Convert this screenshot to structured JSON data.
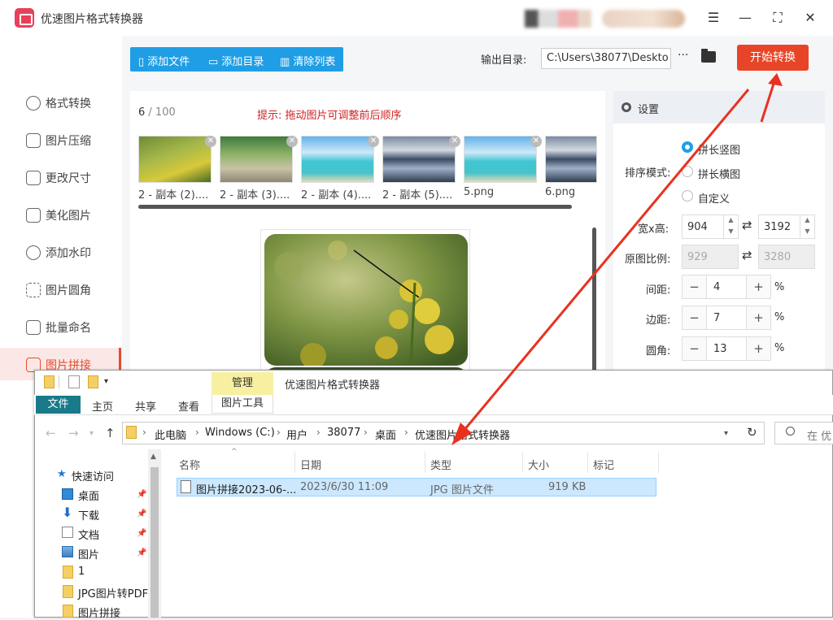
{
  "app": {
    "title": "优速图片格式转换器"
  },
  "window_controls": {
    "menu": "☰",
    "minimize": "—",
    "maximize": "⛶",
    "close": "✕"
  },
  "sidebar": {
    "items": [
      {
        "label": "格式转换",
        "icon": "convert-icon"
      },
      {
        "label": "图片压缩",
        "icon": "compress-icon"
      },
      {
        "label": "更改尺寸",
        "icon": "resize-icon"
      },
      {
        "label": "美化图片",
        "icon": "beautify-icon"
      },
      {
        "label": "添加水印",
        "icon": "watermark-icon"
      },
      {
        "label": "图片圆角",
        "icon": "round-corner-icon"
      },
      {
        "label": "批量命名",
        "icon": "rename-icon"
      },
      {
        "label": "图片拼接",
        "icon": "stitch-icon",
        "active": true
      }
    ]
  },
  "toolbar": {
    "add_file": "添加文件",
    "add_dir": "添加目录",
    "clear_list": "清除列表",
    "output_label": "输出目录:",
    "output_path": "C:\\Users\\38077\\Deskto",
    "more": "···",
    "start": "开始转换"
  },
  "list": {
    "count": "6",
    "max": "/ 100",
    "hint": "提示: 拖动图片可调整前后顺序",
    "thumbs": [
      {
        "label": "2 - 副本 (2)....",
        "kind": "flower"
      },
      {
        "label": "2 - 副本 (3)....",
        "kind": "river"
      },
      {
        "label": "2 - 副本 (4)....",
        "kind": "beach"
      },
      {
        "label": "2 - 副本 (5)....",
        "kind": "mountain"
      },
      {
        "label": "5.png",
        "kind": "beach"
      },
      {
        "label": "6.png",
        "kind": "mountain"
      }
    ]
  },
  "settings": {
    "title": "设置",
    "sort_label": "排序模式:",
    "sort_options": [
      "拼长竖图",
      "拼长横图",
      "自定义"
    ],
    "sort_selected": 0,
    "wh_label": "宽x高:",
    "width": "904",
    "height": "3192",
    "ratio_label": "原图比例:",
    "ratio_w": "929",
    "ratio_h": "3280",
    "spacing_label": "间距:",
    "spacing": "4",
    "margin_label": "边距:",
    "margin": "7",
    "corner_label": "圆角:",
    "corner": "13",
    "unit": "%"
  },
  "explorer": {
    "title": "优速图片格式转换器",
    "manage_tab": "管理",
    "tabs": [
      "文件",
      "主页",
      "共享",
      "查看"
    ],
    "picture_tools": "图片工具",
    "breadcrumb": [
      "此电脑",
      "Windows (C:)",
      "用户",
      "38077",
      "桌面",
      "优速图片格式转换器"
    ],
    "search_placeholder": "在 优",
    "nav": [
      {
        "label": "快速访问",
        "icon": "star-icon"
      },
      {
        "label": "桌面",
        "icon": "desktop-icon",
        "pinned": true
      },
      {
        "label": "下载",
        "icon": "download-icon",
        "pinned": true
      },
      {
        "label": "文档",
        "icon": "document-icon",
        "pinned": true
      },
      {
        "label": "图片",
        "icon": "pictures-icon",
        "pinned": true
      },
      {
        "label": "1",
        "icon": "folder-icon"
      },
      {
        "label": "JPG图片转PDF",
        "icon": "folder-icon"
      },
      {
        "label": "图片拼接",
        "icon": "folder-icon"
      }
    ],
    "columns": [
      "名称",
      "日期",
      "类型",
      "大小",
      "标记"
    ],
    "files": [
      {
        "name": "图片拼接2023-06-...",
        "date": "2023/6/30 11:09",
        "type": "JPG 图片文件",
        "size": "919 KB"
      }
    ]
  },
  "colors": {
    "accent": "#1f9ee6",
    "start": "#e84528",
    "hint": "#d02323",
    "arrow": "#e8321f"
  }
}
